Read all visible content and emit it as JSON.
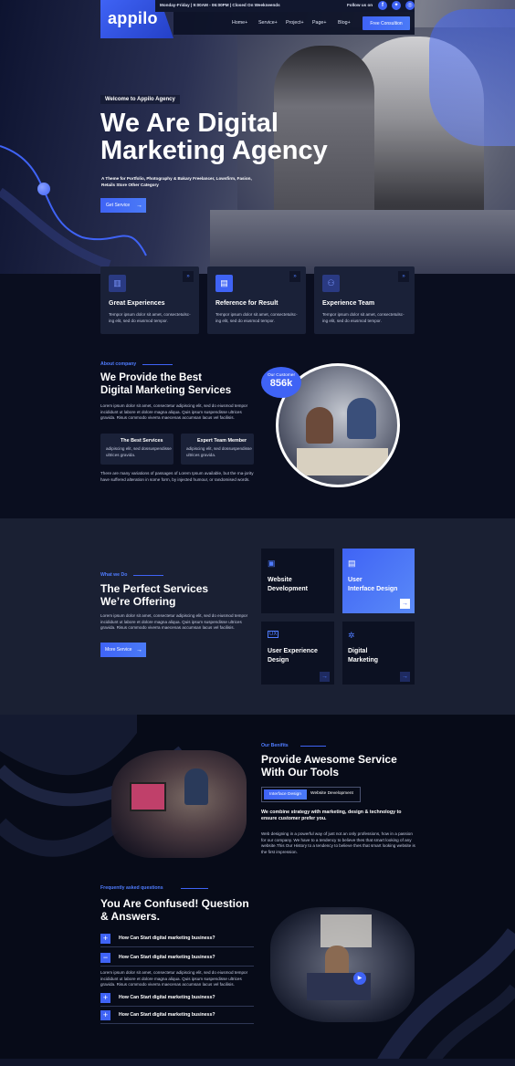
{
  "brand": {
    "name": "appilo"
  },
  "topbar": {
    "hours": "Monday-Friday | 9:00AM - 06:00PM | Closed On Weekneends",
    "follow": "Follow us on"
  },
  "nav": {
    "items": [
      "Home+",
      "Service+",
      "Project+",
      "Page+",
      "Blog+"
    ],
    "cta": "Free Consultion"
  },
  "hero": {
    "badge": "Welcome to Appilo Agency",
    "title_line1": "We Are Digital",
    "title_line2": "Marketing Agency",
    "subtitle_line1": "A Theme for Portfolio, Photography & Bakary Freelancer, Lowsfirm, Fasion,",
    "subtitle_line2": "Retails Store Other Category",
    "button": "Get Service"
  },
  "features": [
    {
      "title": "Great Experiences",
      "text1": "Tempor ipsum dolor sit amet, consectetulsc-",
      "text2": "ing elit, sed do eiusmod tempor."
    },
    {
      "title": "Reference for Result",
      "text1": "Tempor ipsum dolor sit amet, consectetulsc-",
      "text2": "ing elit, sed do eiusmod tempor."
    },
    {
      "title": "Experience Team",
      "text1": "Tempor ipsum dolor sit amet, consectetulsc-",
      "text2": "ing elit, sed do eiusmod tempor."
    }
  ],
  "about": {
    "tag": "About company",
    "title_line1": "We Provide the Best",
    "title_line2": "Digital Marketing Services",
    "para1": "Lorem ipsum dolor sit amet, consectetur adipiscing elit, sed do eiusmod tempor incididunt ut labore et dolore magna aliqua. Quis ipsum suspendisse ultrices gravida. Risus commodo viverra maecenas accumsan lacus vel facilisis.",
    "box1_title": "The Best Services",
    "box1_text": "adipiscing elit, sed dossuspendisse ultrices gravida.",
    "box2_title": "Expert Team Member",
    "box2_text": "adipiscing elit, sed dossuspendisse ultrices gravida.",
    "para2": "There are many variations of passages of Lorem Ipsum available, but the ma-jority have suffered alteration in some form, by injected humour, or randomised words.",
    "customer_label": "Our Customer",
    "customer_count": "856k"
  },
  "services": {
    "tag": "What we Do",
    "title_line1": "The Perfect Services",
    "title_line2": "We’re Offering",
    "para": "Lorem ipsum dolor sit amet, consectetur adipiscing elit, sed do eiusmod tempor incididunt ut labore et dolore magna aliqua. Quis ipsum suspendisse ultrices gravida. Risus commodo viverra maecenas accumsan lacus vel facilisis.",
    "button": "More Service",
    "cards": [
      {
        "line1": "Website",
        "line2": "Development"
      },
      {
        "line1": "User",
        "line2": "Interface Design"
      },
      {
        "line1": "User Experience",
        "line2": "Design"
      },
      {
        "line1": "Digital",
        "line2": "Marketing"
      }
    ]
  },
  "benefits": {
    "tag": "Our Benifits",
    "title_line1": "Provide Awesome Service",
    "title_line2": "With Our Tools",
    "tab_active": "Interface Design",
    "tab_inactive": "Website Development",
    "bold_text": "We combine strategy with marketing, design & technology to ensure customer prefer you.",
    "para": "Web designing in a powerful way of just not an only professions, how in a passion for our company. We have to a tendency to believe thes that smart looking of any website.This Our History to a tendency to believe thes that smart looking website is the first impression."
  },
  "faq": {
    "tag": "Frequently asked questions",
    "title_line1": "You Are Confused! Question",
    "title_line2": "& Answers.",
    "items": [
      {
        "icon": "+",
        "question": "How Can Start digital marketing business?"
      },
      {
        "icon": "−",
        "question": "How Can Start digital marketing business?"
      },
      {
        "icon": "+",
        "question": "How Can Start digital marketing business?"
      },
      {
        "icon": "+",
        "question": "How Can Start digital marketing business?"
      }
    ],
    "answer": "Lorem ipsum dolor sit amet, consectetur adipiscing elit, sed do eiusmod tempor incididunt ut labore et dolore magna aliqua. Quis ipsum suspendisse ultrices gravida. Risus commodo viverra maecenas accumsan lacus vel facilisis."
  },
  "colors": {
    "accent": "#3f63f5",
    "dark": "#0b1022",
    "card": "#1a2138"
  }
}
